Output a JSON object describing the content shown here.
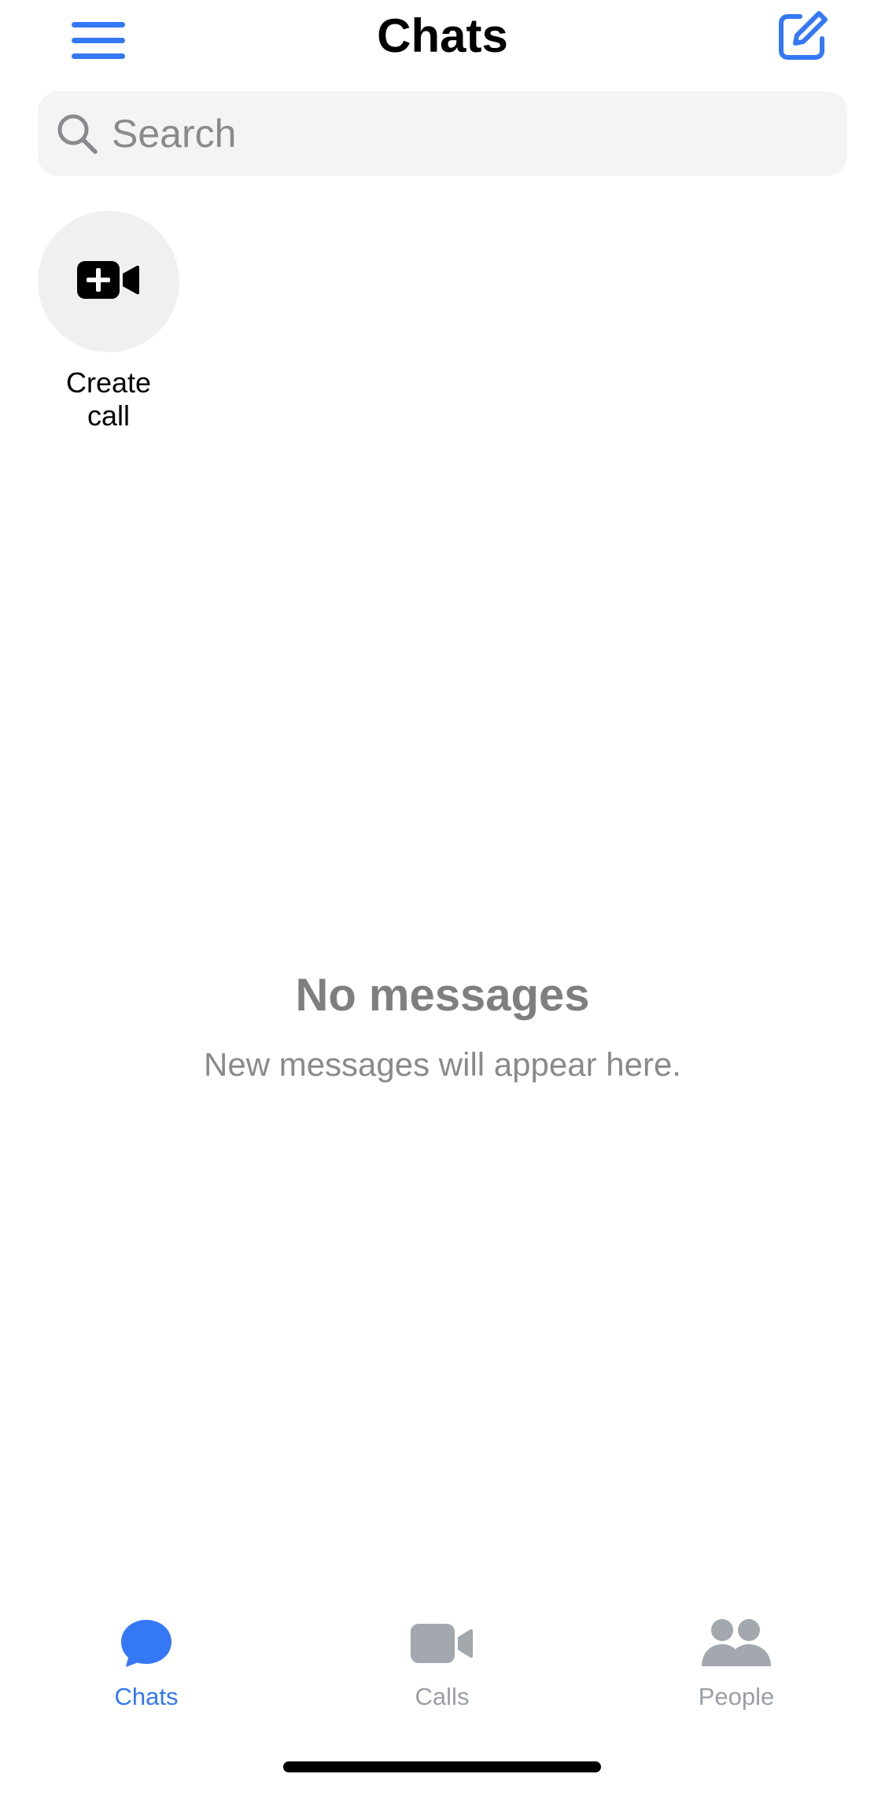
{
  "header": {
    "title": "Chats",
    "menu_icon": "hamburger-menu-icon",
    "compose_icon": "compose-icon"
  },
  "search": {
    "placeholder": "Search",
    "value": "",
    "icon": "search-icon"
  },
  "create_call": {
    "label_line1": "Create",
    "label_line2": "call",
    "icon": "video-plus-icon"
  },
  "empty_state": {
    "title": "No messages",
    "subtitle": "New messages will appear here."
  },
  "tab_bar": {
    "tabs": [
      {
        "label": "Chats",
        "icon": "chat-bubble-icon",
        "active": true
      },
      {
        "label": "Calls",
        "icon": "video-camera-icon",
        "active": false
      },
      {
        "label": "People",
        "icon": "people-icon",
        "active": false
      }
    ]
  },
  "colors": {
    "accent": "#3478f6",
    "inactive": "#9a9ea6",
    "search_bg": "#f4f4f4",
    "empty_text": "#7f7f7f"
  }
}
